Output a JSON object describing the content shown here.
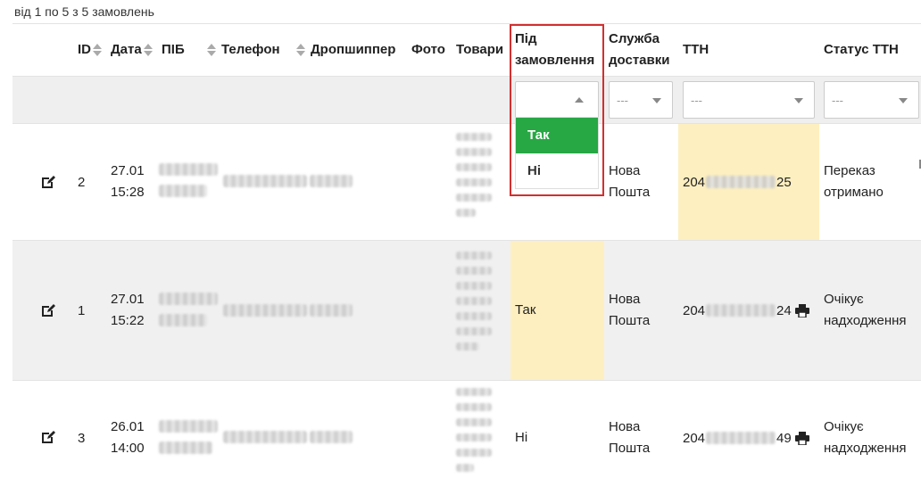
{
  "summary": "від 1 по 5 з 5 замовлень",
  "columns": {
    "id": "ID",
    "date": "Дата",
    "name": "ПІБ",
    "phone": "Телефон",
    "dropshipper": "Дропшиппер",
    "photo": "Фото",
    "goods": "Товари",
    "under_order_l1": "Під",
    "under_order_l2": "замовлення",
    "delivery_l1": "Служба",
    "delivery_l2": "доставки",
    "ttn": "ТТН",
    "ttn_status": "Статус ТТН"
  },
  "filters": {
    "delivery_placeholder": "---",
    "ttn_placeholder": "---",
    "ttn_status_placeholder": "---"
  },
  "dropdown": {
    "options": [
      "Так",
      "Ні"
    ],
    "highlighted": "Так"
  },
  "rows": [
    {
      "id": "2",
      "date": "27.01",
      "time": "15:28",
      "under_order": "",
      "delivery_l1": "Нова",
      "delivery_l2": "Пошта",
      "ttn_prefix": "204",
      "ttn_suffix": "25",
      "status_l1": "Переказ",
      "status_l2": "отримано"
    },
    {
      "id": "1",
      "date": "27.01",
      "time": "15:22",
      "under_order": "Так",
      "delivery_l1": "Нова",
      "delivery_l2": "Пошта",
      "ttn_prefix": "204",
      "ttn_suffix": "24",
      "status_l1": "Очікує",
      "status_l2": "надходження"
    },
    {
      "id": "3",
      "date": "26.01",
      "time": "14:00",
      "under_order": "Ні",
      "delivery_l1": "Нова",
      "delivery_l2": "Пошта",
      "ttn_prefix": "204",
      "ttn_suffix": "49",
      "status_l1": "Очікує",
      "status_l2": "надходження"
    }
  ],
  "colors": {
    "accent_green": "#28a745",
    "highlight_yellow": "#fdefc0",
    "highlight_border": "#d32f2f"
  }
}
